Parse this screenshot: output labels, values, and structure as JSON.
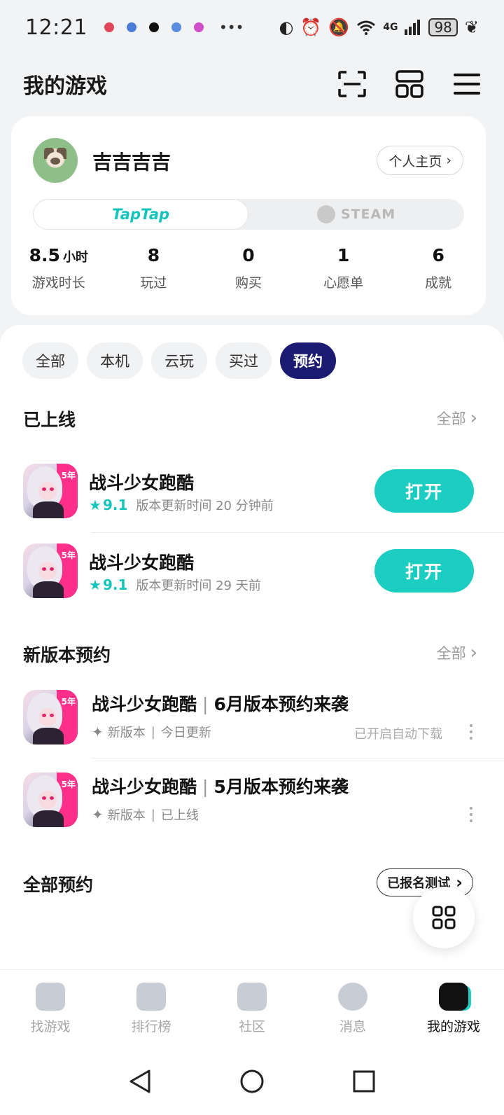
{
  "status_bar": {
    "time": "12:21",
    "notification_colors": [
      "#e0455a",
      "#4c7bd9",
      "#111111",
      "#5a8de0",
      "#d04fc8"
    ],
    "more": "•••",
    "network": "4G",
    "battery": "98"
  },
  "header": {
    "title": "我的游戏",
    "icons": [
      "scan-icon",
      "layout-icon",
      "menu-icon"
    ]
  },
  "profile": {
    "username": "吉吉吉吉",
    "homepage_label": "个人主页",
    "platforms": [
      {
        "label": "TapTap",
        "active": true
      },
      {
        "label": "STEAM",
        "active": false
      }
    ],
    "stats": [
      {
        "value": "8.5",
        "unit": "小时",
        "label": "游戏时长"
      },
      {
        "value": "8",
        "unit": "",
        "label": "玩过"
      },
      {
        "value": "0",
        "unit": "",
        "label": "购买"
      },
      {
        "value": "1",
        "unit": "",
        "label": "心愿单"
      },
      {
        "value": "6",
        "unit": "",
        "label": "成就"
      }
    ]
  },
  "filters": [
    "全部",
    "本机",
    "云玩",
    "买过",
    "预约"
  ],
  "active_filter": "预约",
  "sections": {
    "online": {
      "title": "已上线",
      "more": "全部",
      "games": [
        {
          "name": "战斗少女跑酷",
          "rating": "9.1",
          "update": "版本更新时间 20 分钟前",
          "action": "打开"
        },
        {
          "name": "战斗少女跑酷",
          "rating": "9.1",
          "update": "版本更新时间 29 天前",
          "action": "打开"
        }
      ]
    },
    "new_version": {
      "title": "新版本预约",
      "more": "全部",
      "items": [
        {
          "game": "战斗少女跑酷",
          "event": "6月版本预约来袭",
          "tag": "新版本",
          "status": "今日更新",
          "auto": "已开启自动下载"
        },
        {
          "game": "战斗少女跑酷",
          "event": "5月版本预约来袭",
          "tag": "新版本",
          "status": "已上线",
          "auto": ""
        }
      ]
    },
    "all_reservations": {
      "title": "全部预约",
      "button": "已报名测试"
    }
  },
  "bottom_nav": [
    {
      "label": "找游戏",
      "active": false
    },
    {
      "label": "排行榜",
      "active": false
    },
    {
      "label": "社区",
      "active": false
    },
    {
      "label": "消息",
      "active": false
    },
    {
      "label": "我的游戏",
      "active": true
    }
  ],
  "colors": {
    "accent": "#1ccdc1",
    "active_chip": "#1c1b72",
    "tag_pink": "#ff2f8a"
  }
}
